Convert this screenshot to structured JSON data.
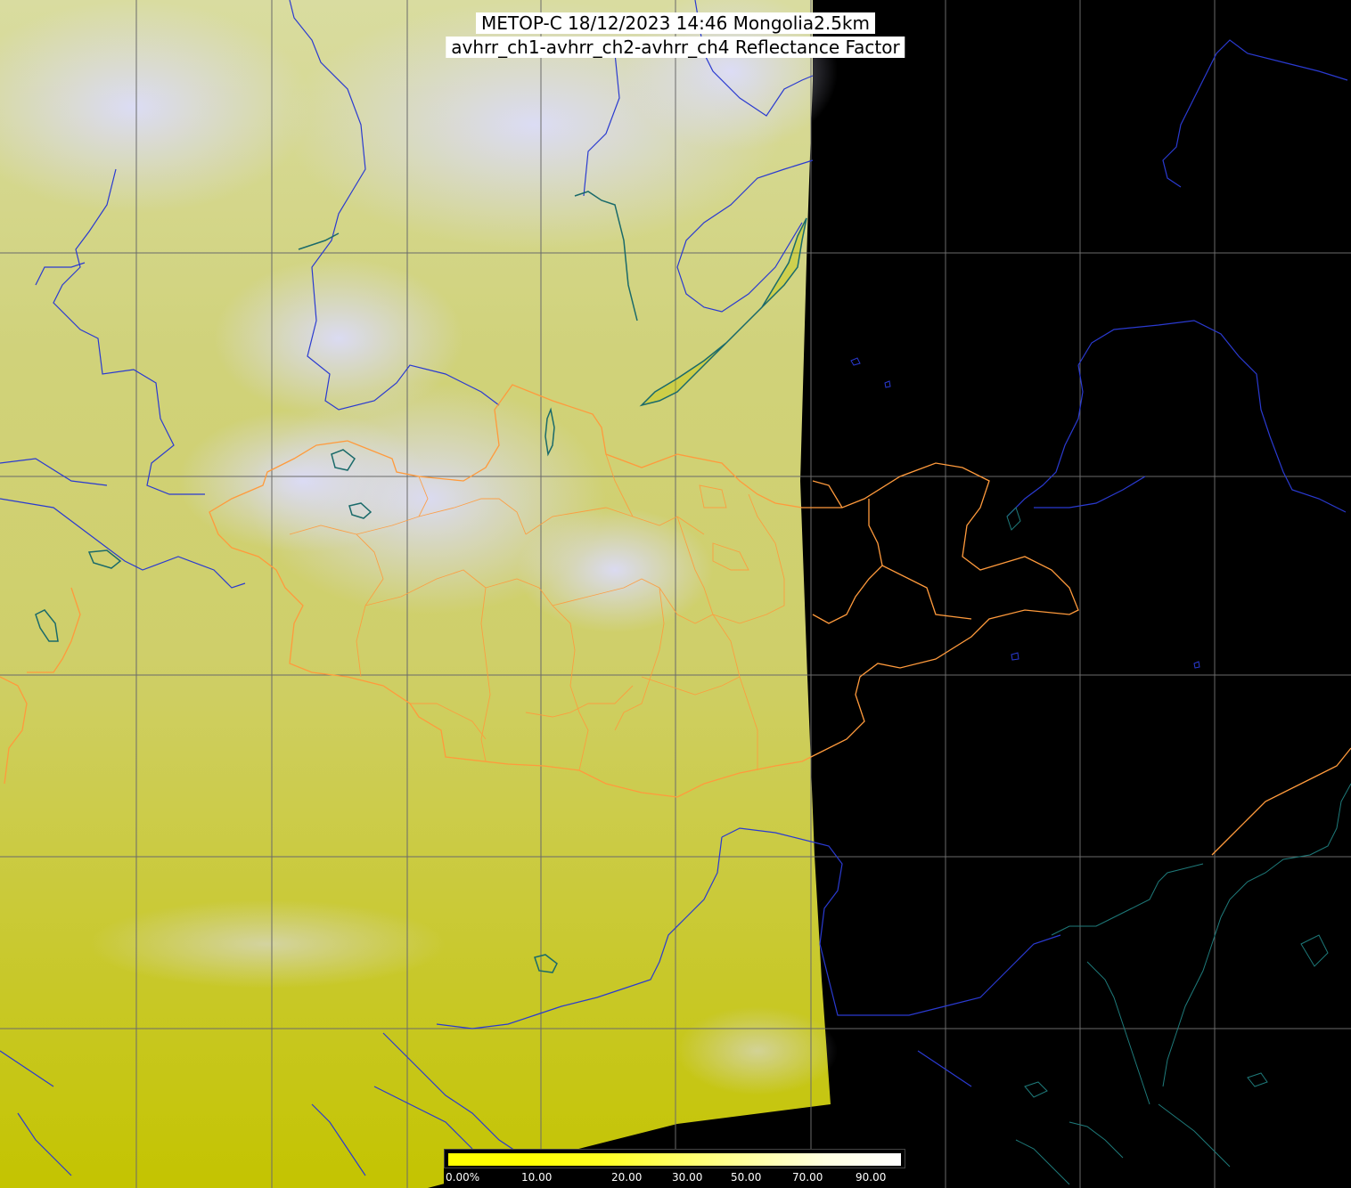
{
  "title": {
    "line1": "METOP-C 18/12/2023 14:46 Mongolia2.5km",
    "line2": "avhrr_ch1-avhrr_ch2-avhrr_ch4 Reflectance Factor"
  },
  "colors": {
    "background": "#000000",
    "imagery_yellow": "#c8c800",
    "imagery_light": "#d8d8f0",
    "graticule": "#6a6a6a",
    "rivers": "#2a3ad0",
    "country_borders": "#ff9a3c",
    "coastline": "#1e7a7a"
  },
  "colorbar": {
    "stops": [
      "#ffff00",
      "#ffff00",
      "#ffff20",
      "#ffff60",
      "#ffffa0",
      "#ffffe0",
      "#ffffff"
    ],
    "labels": [
      "0.00%",
      "10.00",
      "20.00",
      "30.00",
      "50.00",
      "70.00",
      "90.00"
    ]
  }
}
